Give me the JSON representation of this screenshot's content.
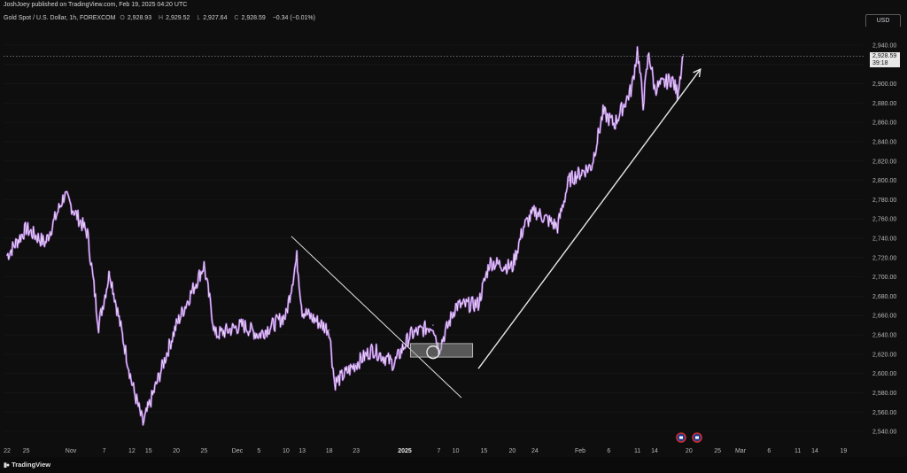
{
  "publisher_line": "JoshJoey published on TradingView.com, Feb 19, 2025 04:20 UTC",
  "symbol": {
    "name": "Gold Spot / U.S. Dollar, 1h, FOREXCOM",
    "open_label": "O",
    "open": "2,928.93",
    "high_label": "H",
    "high": "2,929.52",
    "low_label": "L",
    "low": "2,927.64",
    "close_label": "C",
    "close": "2,928.59",
    "change": "−0.34 (−0.01%)"
  },
  "currency": "USD",
  "last_price": {
    "price": "2,928.59",
    "countdown": "39:18"
  },
  "footer": {
    "brand": "TradingView"
  },
  "colors": {
    "candle": "#c79be8",
    "drawing": "#e6e6e6",
    "background": "#0e0e0e"
  },
  "icons": [
    "us-flag-event-icon",
    "us-flag-event-icon"
  ],
  "chart_data": {
    "type": "line",
    "instrument": "Gold Spot / U.S. Dollar",
    "ylim": [
      2530,
      2950
    ],
    "y_ticks": [
      2540,
      2560,
      2580,
      2600,
      2620,
      2640,
      2660,
      2680,
      2700,
      2720,
      2740,
      2760,
      2780,
      2800,
      2820,
      2840,
      2860,
      2880,
      2900,
      2920,
      2940
    ],
    "y_tick_labels": [
      "2,540.00",
      "2,560.00",
      "2,580.00",
      "2,600.00",
      "2,620.00",
      "2,640.00",
      "2,660.00",
      "2,680.00",
      "2,700.00",
      "2,720.00",
      "2,740.00",
      "2,760.00",
      "2,780.00",
      "2,800.00",
      "2,820.00",
      "2,840.00",
      "2,860.00",
      "2,880.00",
      "2,900.00",
      "2,920.00",
      "2,940.00"
    ],
    "x_ticks": [
      "22",
      "25",
      "Nov",
      "7",
      "12",
      "15",
      "20",
      "25",
      "Dec",
      "5",
      "10",
      "13",
      "18",
      "23",
      "2025",
      "7",
      "10",
      "15",
      "20",
      "24",
      "Feb",
      "6",
      "11",
      "14",
      "20",
      "25",
      "Mar",
      "6",
      "11",
      "14",
      "19"
    ],
    "x": [
      "Oct 22",
      "Oct 25",
      "Oct 28",
      "Oct 31",
      "Nov 4",
      "Nov 6",
      "Nov 8",
      "Nov 12",
      "Nov 14",
      "Nov 15",
      "Nov 20",
      "Nov 25",
      "Nov 27",
      "Dec 2",
      "Dec 5",
      "Dec 10",
      "Dec 12",
      "Dec 13",
      "Dec 18",
      "Dec 19",
      "Dec 23",
      "Dec 26",
      "Dec 30",
      "Jan 2",
      "Jan 6",
      "Jan 7",
      "Jan 10",
      "Jan 14",
      "Jan 16",
      "Jan 20",
      "Jan 22",
      "Jan 24",
      "Jan 28",
      "Jan 30",
      "Feb 3",
      "Feb 5",
      "Feb 7",
      "Feb 10",
      "Feb 11",
      "Feb 12",
      "Feb 13",
      "Feb 14",
      "Feb 17",
      "Feb 18",
      "Feb 19"
    ],
    "y": [
      2722,
      2750,
      2735,
      2785,
      2745,
      2650,
      2705,
      2590,
      2548,
      2565,
      2650,
      2712,
      2640,
      2650,
      2640,
      2660,
      2720,
      2665,
      2645,
      2590,
      2610,
      2625,
      2610,
      2640,
      2650,
      2625,
      2670,
      2672,
      2715,
      2710,
      2752,
      2768,
      2752,
      2800,
      2815,
      2870,
      2858,
      2895,
      2935,
      2880,
      2932,
      2895,
      2905,
      2890,
      2930
    ],
    "last": 2928.59,
    "annotations": [
      {
        "type": "trendline",
        "from": [
          "Dec 11",
          2742
        ],
        "to": [
          "Jan 11",
          2575
        ]
      },
      {
        "type": "arrow",
        "from": [
          "Jan 14",
          2605
        ],
        "to": [
          "Feb 22",
          2915
        ]
      },
      {
        "type": "rectangle",
        "x": [
          "Jan 2",
          "Jan 13"
        ],
        "y": [
          2617,
          2631
        ]
      },
      {
        "type": "circle",
        "center": [
          "Jan 6",
          2622
        ],
        "radius": 7
      }
    ]
  }
}
